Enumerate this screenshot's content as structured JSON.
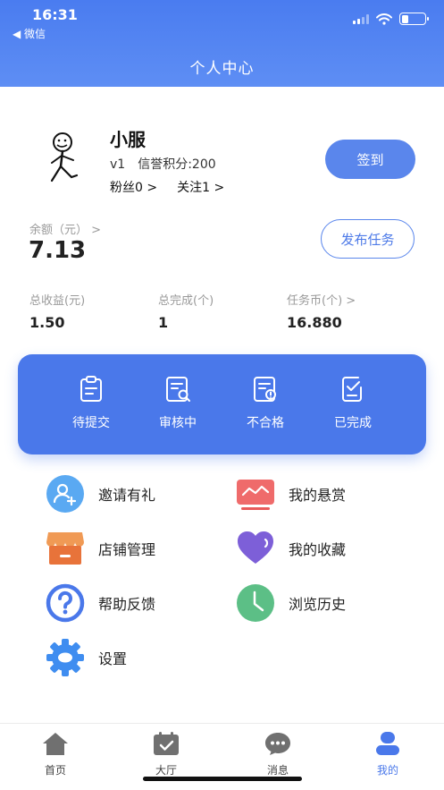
{
  "status_bar": {
    "time": "16:31",
    "back_label": "◀ 微信"
  },
  "header": {
    "title": "个人中心"
  },
  "profile": {
    "username": "小服",
    "level": "v1",
    "credit": "信誉积分:200",
    "fans": "粉丝0 >",
    "following": "关注1 >",
    "checkin_label": "签到"
  },
  "balance": {
    "label": "余额（元） >",
    "value": "7.13",
    "publish_label": "发布任务"
  },
  "stats": [
    {
      "label": "总收益(元)",
      "value": "1.50"
    },
    {
      "label": "总完成(个)",
      "value": "1"
    },
    {
      "label": "任务币(个) >",
      "value": "16.880"
    }
  ],
  "task_status": [
    {
      "label": "待提交",
      "icon": "clipboard-icon"
    },
    {
      "label": "审核中",
      "icon": "document-search-icon"
    },
    {
      "label": "不合格",
      "icon": "document-alert-icon"
    },
    {
      "label": "已完成",
      "icon": "document-check-icon"
    }
  ],
  "menu": [
    {
      "label": "邀请有礼",
      "icon": "invite-user-icon"
    },
    {
      "label": "我的悬赏",
      "icon": "reward-icon"
    },
    {
      "label": "店铺管理",
      "icon": "store-icon"
    },
    {
      "label": "我的收藏",
      "icon": "heart-icon"
    },
    {
      "label": "帮助反馈",
      "icon": "help-icon"
    },
    {
      "label": "浏览历史",
      "icon": "clock-icon"
    },
    {
      "label": "设置",
      "icon": "settings-gear-icon"
    }
  ],
  "tabbar": {
    "items": [
      {
        "label": "首页",
        "icon": "home-icon"
      },
      {
        "label": "大厅",
        "icon": "calendar-hall-icon"
      },
      {
        "label": "消息",
        "icon": "chat-bubble-icon"
      },
      {
        "label": "我的",
        "icon": "user-icon"
      }
    ],
    "active_index": 3
  },
  "colors": {
    "primary": "#4a78ea",
    "header_gradient_start": "#4a7cf0",
    "header_gradient_end": "#5e8ef4"
  }
}
